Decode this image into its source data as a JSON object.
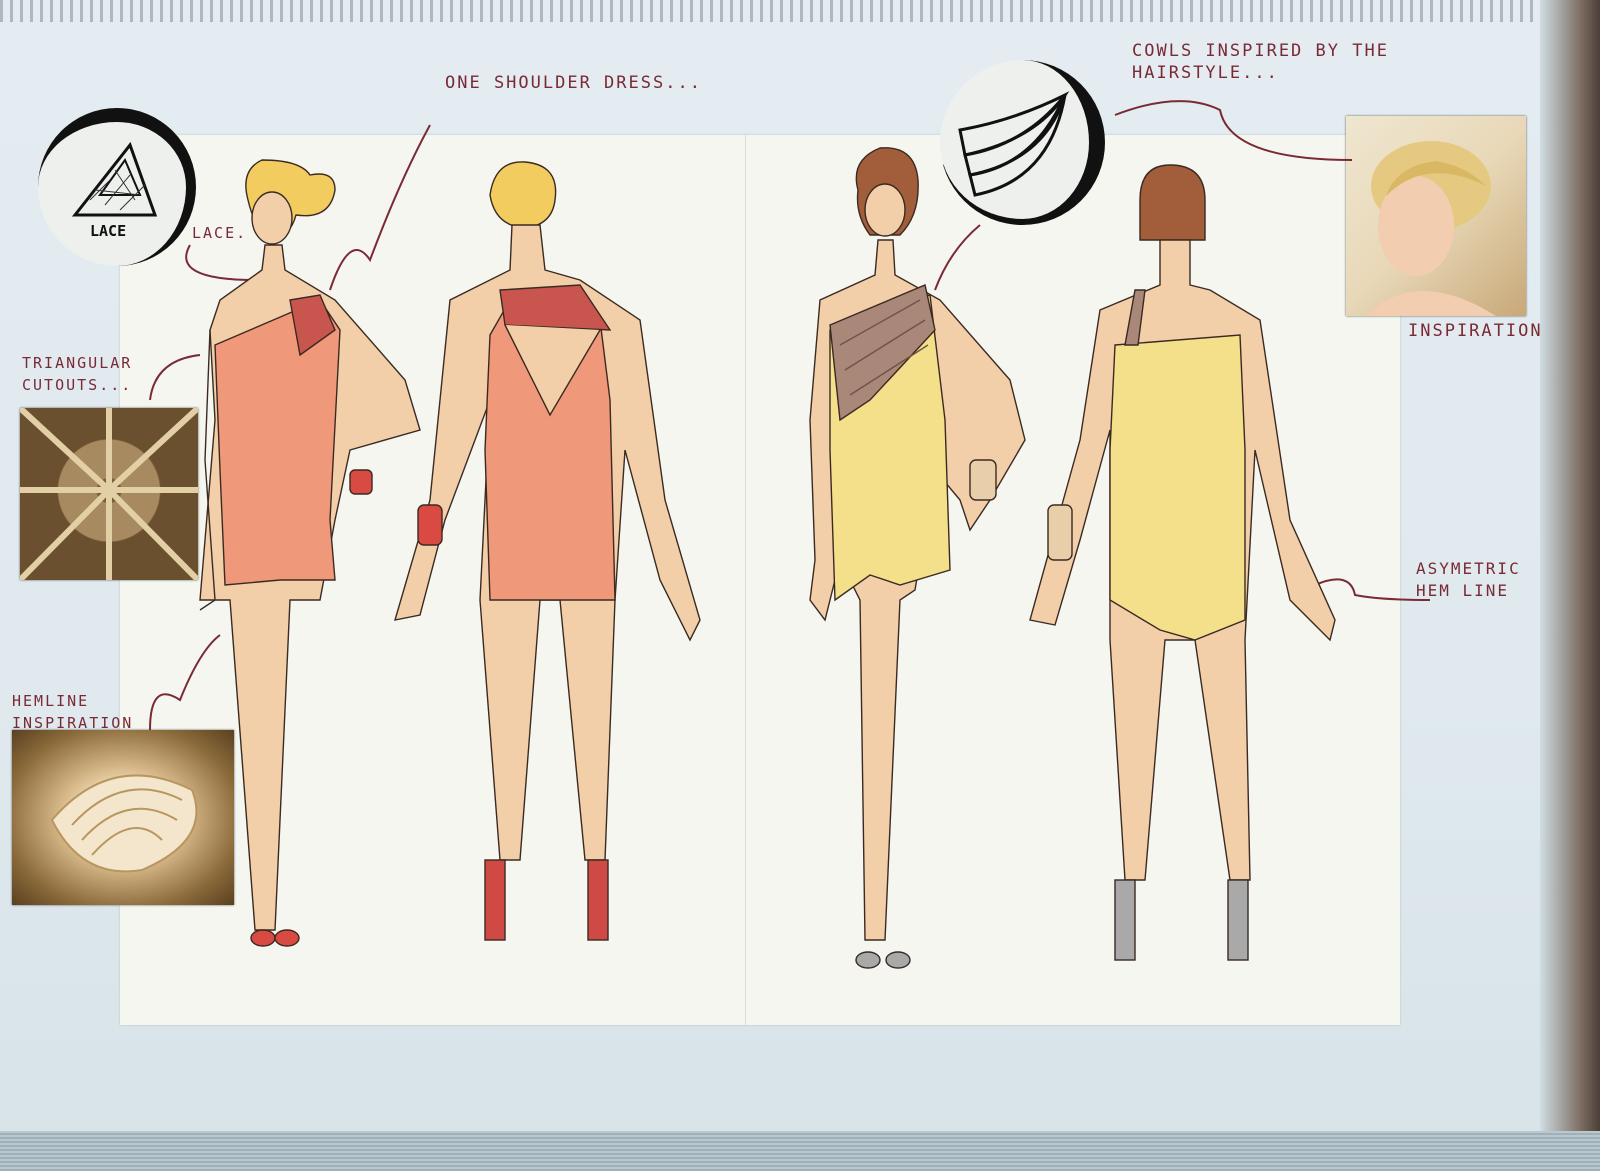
{
  "labels": {
    "title": "ONE SHOULDER DRESS...",
    "lace_badge": "LACE",
    "lace_note": "LACE.",
    "triangular": "TRIANGULAR\nCUTOUTS...",
    "hemline": "HEMLINE\nINSPIRATION",
    "cowls": "COWLS INSPIRED BY THE\nHAIRSTYLE...",
    "inspiration": "INSPIRATION",
    "asymetric": "ASYMETRIC\nHEM LINE"
  },
  "colors": {
    "coral_dress": "#f0987a",
    "yellow_dress": "#f4df8a",
    "skin": "#f2cfa8",
    "annotation_ink": "#7a2a35",
    "cowl_drape": "#a9887a"
  },
  "icons": [
    "lace-triangle-icon",
    "cowl-drape-icon"
  ]
}
